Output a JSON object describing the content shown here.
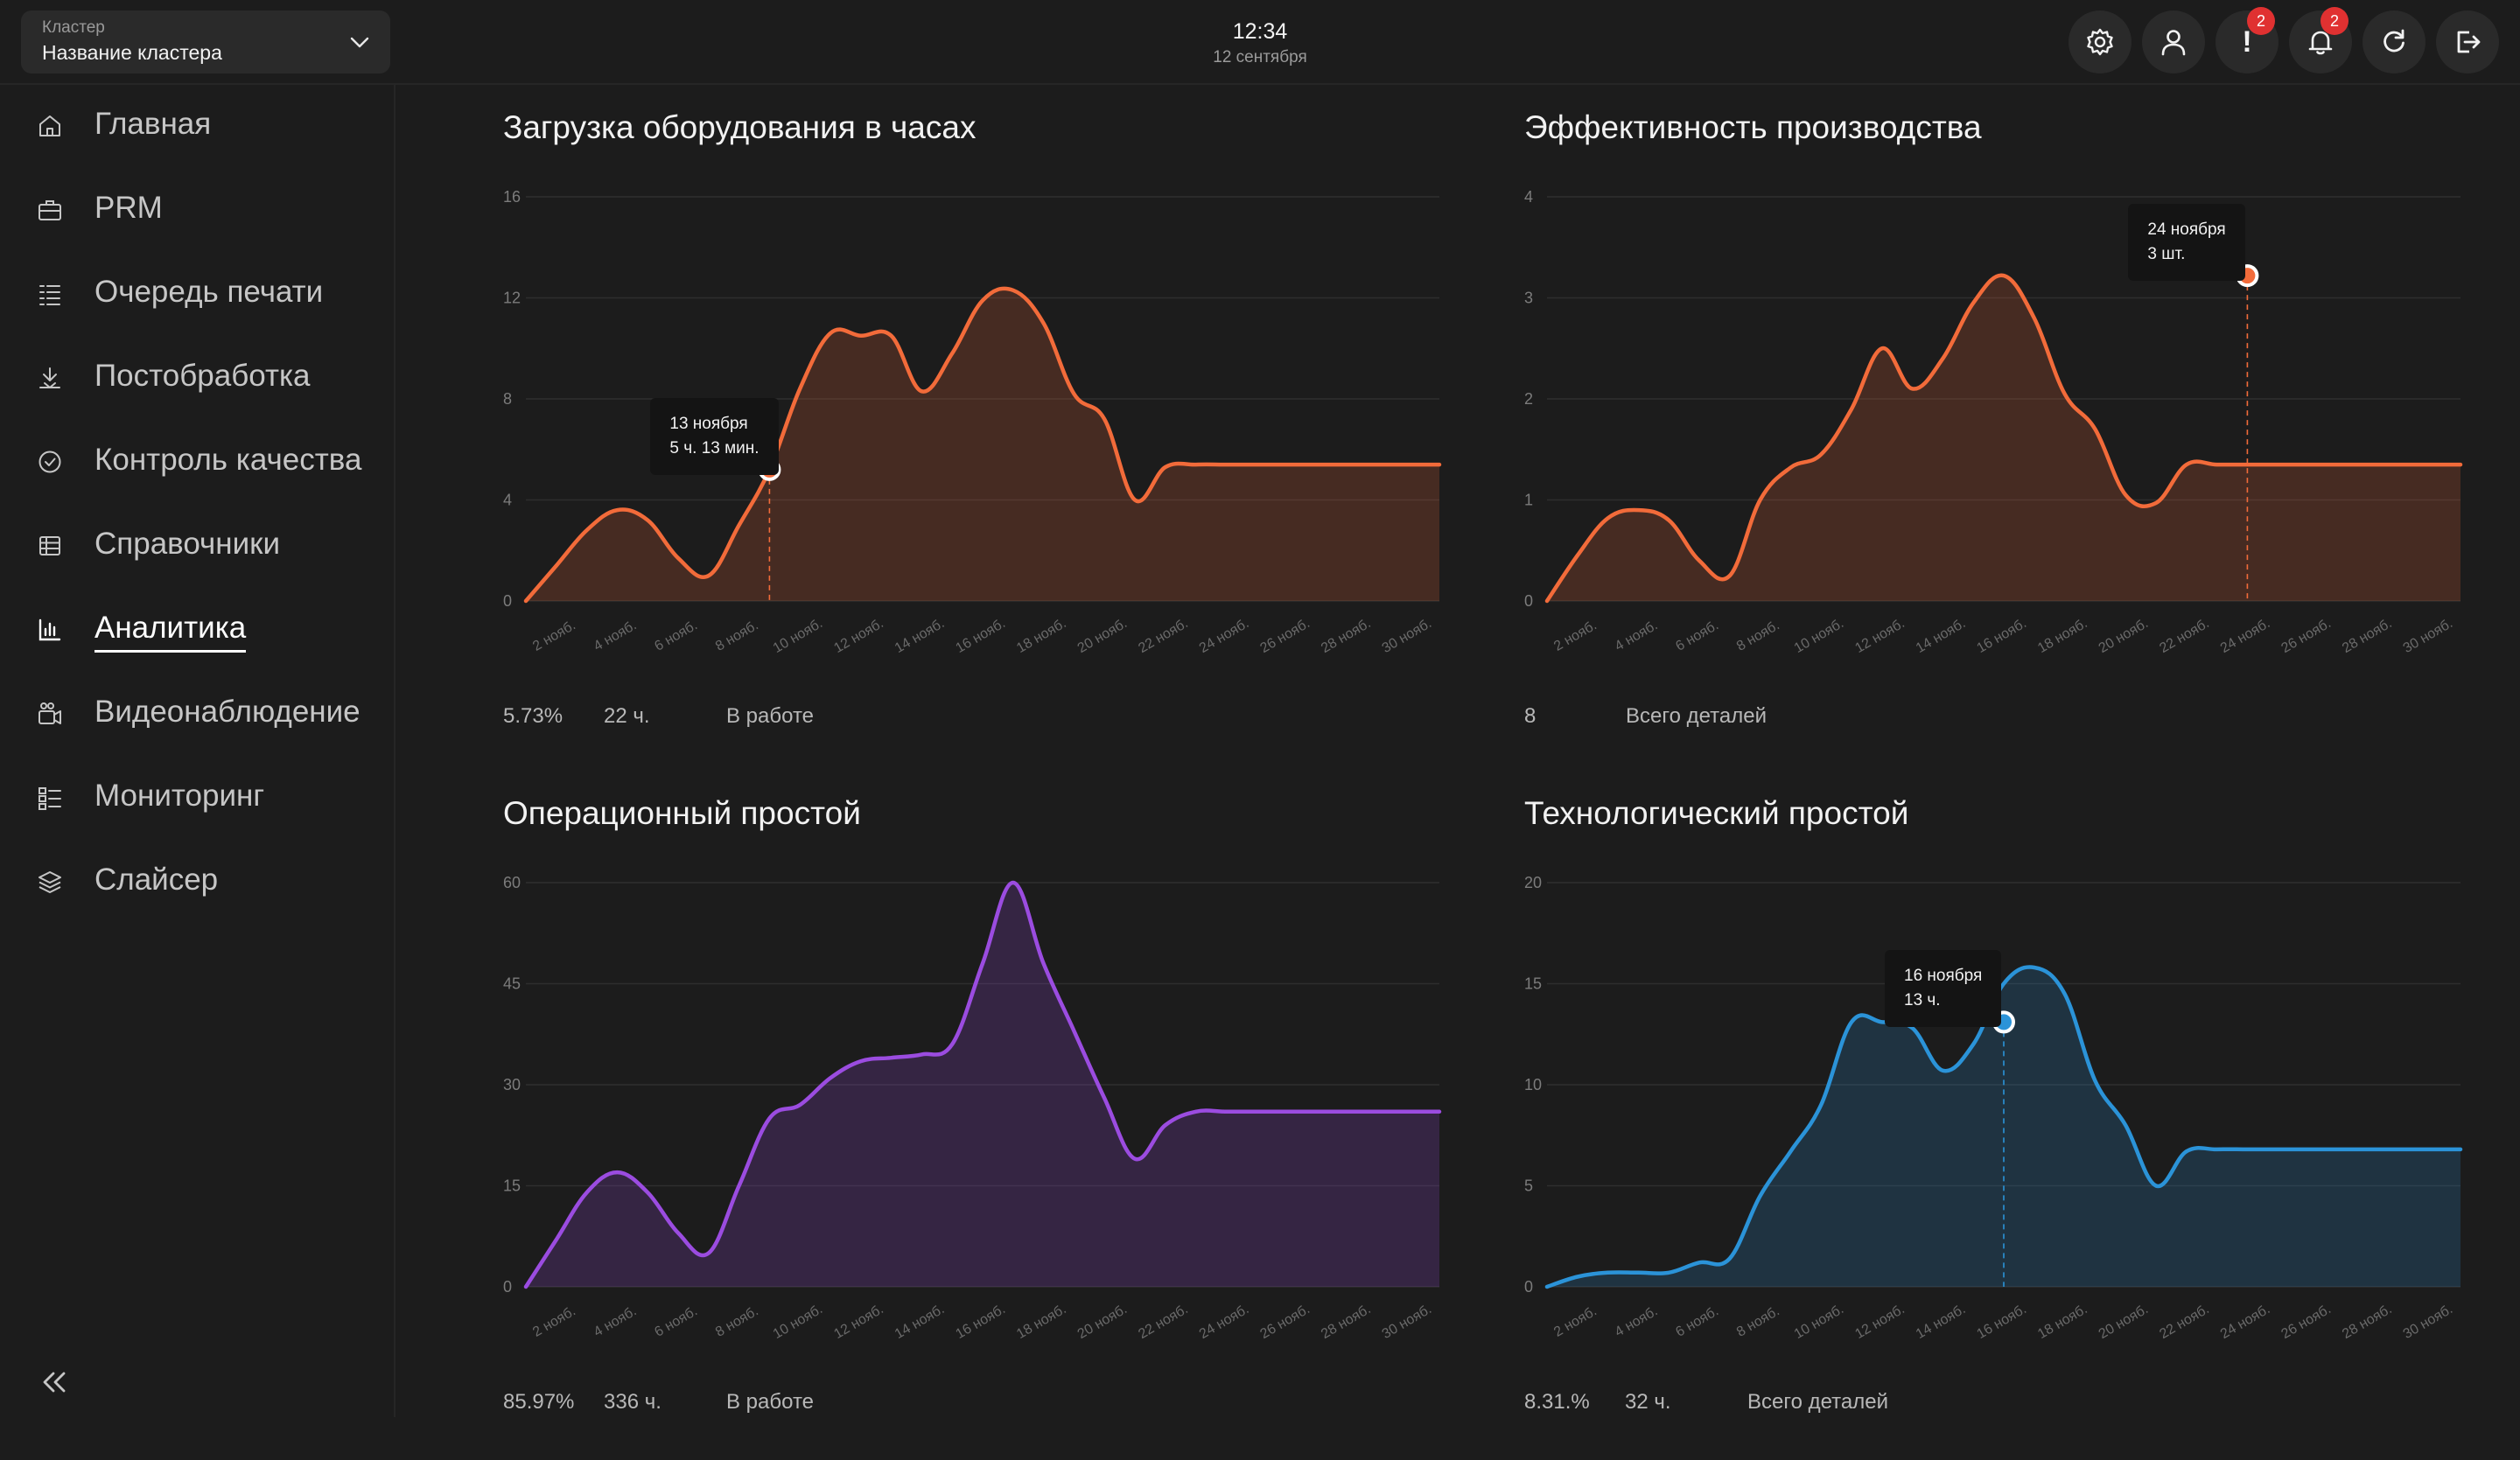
{
  "header": {
    "cluster_label": "Кластер",
    "cluster_value": "Название кластера",
    "time": "12:34",
    "date": "12 сентября",
    "actions": [
      {
        "icon": "gear-icon"
      },
      {
        "icon": "user-icon"
      },
      {
        "icon": "alert-icon",
        "badge": "2"
      },
      {
        "icon": "bell-icon",
        "badge": "2"
      },
      {
        "icon": "refresh-icon"
      },
      {
        "icon": "logout-icon"
      }
    ]
  },
  "sidebar": {
    "items": [
      {
        "label": "Главная",
        "icon": "home-icon"
      },
      {
        "label": "PRM",
        "icon": "briefcase-icon"
      },
      {
        "label": "Очередь печати",
        "icon": "queue-icon"
      },
      {
        "label": "Постобработка",
        "icon": "postprocess-icon"
      },
      {
        "label": "Контроль качества",
        "icon": "check-circle-icon"
      },
      {
        "label": "Справочники",
        "icon": "table-icon"
      },
      {
        "label": "Аналитика",
        "icon": "bar-chart-icon",
        "active": true
      },
      {
        "label": "Видеонаблюдение",
        "icon": "camera-icon"
      },
      {
        "label": "Мониторинг",
        "icon": "list-icon"
      },
      {
        "label": "Слайсер",
        "icon": "layers-icon"
      }
    ],
    "collapse_icon": "double-chevron-left-icon"
  },
  "colors": {
    "orange": "#f26b3a",
    "purple": "#9b4ce0",
    "blue": "#2b93d8",
    "background": "#1c1c1c"
  },
  "chart_data": [
    {
      "type": "area",
      "title": "Загрузка оборудования в часах",
      "x_ticks": [
        "2 нояб.",
        "4 нояб.",
        "6 нояб.",
        "8 нояб.",
        "10 нояб.",
        "12 нояб.",
        "14 нояб.",
        "16 нояб.",
        "18 нояб.",
        "20 нояб.",
        "22 нояб.",
        "24 нояб.",
        "26 нояб.",
        "28 нояб.",
        "30 нояб."
      ],
      "y_ticks": [
        "0",
        "4",
        "8",
        "12",
        "16"
      ],
      "ylim": [
        0,
        16
      ],
      "x": [
        1,
        2,
        3,
        4,
        5,
        6,
        7,
        8,
        9,
        10,
        11,
        12,
        13,
        14,
        15,
        16,
        17,
        18,
        19,
        20,
        21,
        22,
        23,
        24,
        25,
        26,
        27,
        28,
        29,
        30,
        31
      ],
      "values": [
        0,
        1.4,
        2.8,
        3.6,
        3.2,
        1.7,
        1.0,
        3.0,
        5.2,
        8.4,
        10.6,
        10.5,
        10.5,
        8.3,
        9.8,
        11.9,
        12.3,
        11.0,
        8.2,
        7.2,
        4.0,
        5.3,
        5.4,
        5.4,
        5.4,
        5.4,
        5.4,
        5.4,
        5.4,
        5.4,
        5.4
      ],
      "color": "orange",
      "tooltip": {
        "date": "13 ноября",
        "value": "5 ч. 13 мин.",
        "x": 9,
        "y": 5.2
      },
      "stats": [
        {
          "text": "5.73%"
        },
        {
          "text": "22 ч."
        },
        {
          "text": "В работе"
        }
      ]
    },
    {
      "type": "area",
      "title": "Эффективность производства",
      "x_ticks": [
        "2 нояб.",
        "4 нояб.",
        "6 нояб.",
        "8 нояб.",
        "10 нояб.",
        "12 нояб.",
        "14 нояб.",
        "16 нояб.",
        "18 нояб.",
        "20 нояб.",
        "22 нояб.",
        "24 нояб.",
        "26 нояб.",
        "28 нояб.",
        "30 нояб."
      ],
      "y_ticks": [
        "0",
        "1",
        "2",
        "3",
        "4"
      ],
      "ylim": [
        0,
        4
      ],
      "x": [
        1,
        2,
        3,
        4,
        5,
        6,
        7,
        8,
        9,
        10,
        11,
        12,
        13,
        14,
        15,
        16,
        17,
        18,
        19,
        20,
        21,
        22,
        23,
        24,
        25,
        26,
        27,
        28,
        29,
        30,
        31
      ],
      "values": [
        0,
        0.45,
        0.82,
        0.9,
        0.8,
        0.4,
        0.25,
        1.0,
        1.32,
        1.45,
        1.9,
        2.5,
        2.1,
        2.4,
        2.95,
        3.22,
        2.8,
        2.05,
        1.7,
        1.05,
        0.97,
        1.35,
        1.35,
        1.35,
        1.35,
        1.35,
        1.35,
        1.35,
        1.35,
        1.35,
        1.35
      ],
      "color": "orange",
      "tooltip": {
        "date": "24 ноября",
        "value": "3 шт.",
        "x": 24,
        "y": 3.22
      },
      "stats": [
        {
          "text": "8"
        },
        {
          "text": "Всего деталей"
        }
      ]
    },
    {
      "type": "area",
      "title": "Операционный простой",
      "x_ticks": [
        "2 нояб.",
        "4 нояб.",
        "6 нояб.",
        "8 нояб.",
        "10 нояб.",
        "12 нояб.",
        "14 нояб.",
        "16 нояб.",
        "18 нояб.",
        "20 нояб.",
        "22 нояб.",
        "24 нояб.",
        "26 нояб.",
        "28 нояб.",
        "30 нояб."
      ],
      "y_ticks": [
        "0",
        "15",
        "30",
        "45",
        "60"
      ],
      "ylim": [
        0,
        60
      ],
      "x": [
        1,
        2,
        3,
        4,
        5,
        6,
        7,
        8,
        9,
        10,
        11,
        12,
        13,
        14,
        15,
        16,
        17,
        18,
        19,
        20,
        21,
        22,
        23,
        24,
        25,
        26,
        27,
        28,
        29,
        30,
        31
      ],
      "values": [
        0,
        7,
        14,
        17,
        14,
        8,
        5,
        15,
        25,
        27,
        31,
        33.5,
        34,
        34.5,
        36,
        48,
        60,
        48,
        38,
        28,
        19,
        24,
        26,
        26,
        26,
        26,
        26,
        26,
        26,
        26,
        26
      ],
      "color": "purple",
      "stats": [
        {
          "text": "85.97%"
        },
        {
          "text": "336 ч."
        },
        {
          "text": "В работе"
        }
      ]
    },
    {
      "type": "area",
      "title": "Технологический простой",
      "x_ticks": [
        "2 нояб.",
        "4 нояб.",
        "6 нояб.",
        "8 нояб.",
        "10 нояб.",
        "12 нояб.",
        "14 нояб.",
        "16 нояб.",
        "18 нояб.",
        "20 нояб.",
        "22 нояб.",
        "24 нояб.",
        "26 нояб.",
        "28 нояб.",
        "30 нояб."
      ],
      "y_ticks": [
        "0",
        "5",
        "10",
        "15",
        "20"
      ],
      "ylim": [
        0,
        20
      ],
      "x": [
        1,
        2,
        3,
        4,
        5,
        6,
        7,
        8,
        9,
        10,
        11,
        12,
        13,
        14,
        15,
        16,
        17,
        18,
        19,
        20,
        21,
        22,
        23,
        24,
        25,
        26,
        27,
        28,
        29,
        30,
        31
      ],
      "values": [
        0,
        0.5,
        0.7,
        0.7,
        0.7,
        1.2,
        1.4,
        4.5,
        6.7,
        9.0,
        13.1,
        13.1,
        12.8,
        10.7,
        12.0,
        15.0,
        15.8,
        14.5,
        10.2,
        8.0,
        5.0,
        6.7,
        6.8,
        6.8,
        6.8,
        6.8,
        6.8,
        6.8,
        6.8,
        6.8,
        6.8
      ],
      "color": "blue",
      "tooltip": {
        "date": "16 ноября",
        "value": "13 ч.",
        "x": 16,
        "y": 13.1
      },
      "stats": [
        {
          "text": "8.31.%"
        },
        {
          "text": "32 ч."
        },
        {
          "text": "Всего деталей"
        }
      ]
    }
  ]
}
